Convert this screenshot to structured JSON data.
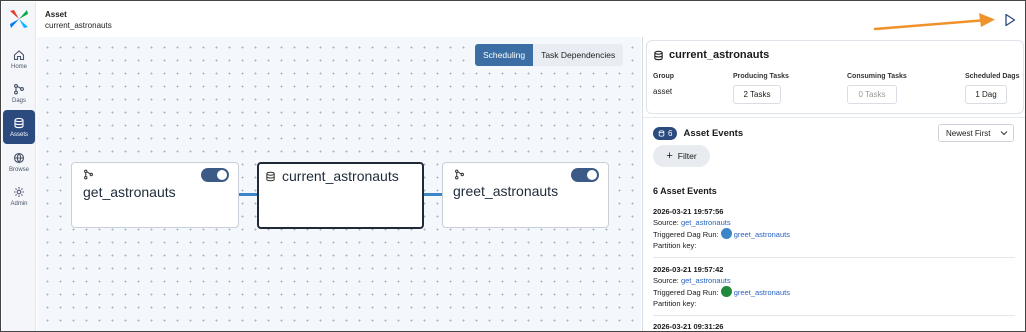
{
  "header": {
    "kind": "Asset",
    "name": "current_astronauts"
  },
  "nav": [
    {
      "label": "Home",
      "icon": "home-icon"
    },
    {
      "label": "Dags",
      "icon": "dags-icon"
    },
    {
      "label": "Assets",
      "icon": "assets-icon",
      "active": true
    },
    {
      "label": "Browse",
      "icon": "globe-icon"
    },
    {
      "label": "Admin",
      "icon": "gear-icon"
    }
  ],
  "graph": {
    "view_tabs": [
      "Scheduling",
      "Task Dependencies"
    ],
    "active_tab": "Scheduling",
    "nodes": {
      "upstream": "get_astronauts",
      "current": "current_astronauts",
      "downstream": "greet_astronauts"
    }
  },
  "asset": {
    "title": "current_astronauts",
    "group_label": "Group",
    "group_value": "asset",
    "producing_label": "Producing Tasks",
    "producing_value": "2 Tasks",
    "consuming_label": "Consuming Tasks",
    "consuming_value": "0 Tasks",
    "scheduled_label": "Scheduled Dags",
    "scheduled_value": "1 Dag"
  },
  "events": {
    "badge_count": "6",
    "title": "Asset Events",
    "sort_value": "Newest First",
    "filter_label": "Filter",
    "count_label": "6 Asset Events",
    "source_label": "Source:",
    "run_label": "Triggered Dag Run:",
    "partition_label": "Partition key:",
    "items": [
      {
        "timestamp": "2026-03-21 19:57:56",
        "source": "get_astronauts",
        "run": "greet_astronauts",
        "run_state": "running"
      },
      {
        "timestamp": "2026-03-21 19:57:42",
        "source": "get_astronauts",
        "run": "greet_astronauts",
        "run_state": "success"
      },
      {
        "timestamp": "2026-03-21 09:31:26"
      }
    ]
  },
  "colors": {
    "accent": "#2b4a7e",
    "edge": "#3a86c8",
    "annotation_arrow": "#f0922b",
    "success": "#1f8a3b",
    "running": "#3a86c8"
  }
}
